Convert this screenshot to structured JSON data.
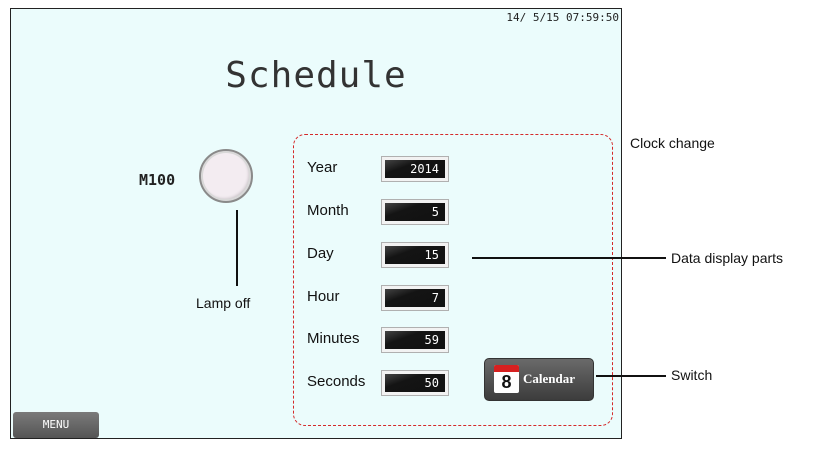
{
  "screen": {
    "clock": "14/ 5/15 07:59:50",
    "title": "Schedule",
    "lamp": {
      "label": "M100",
      "state": "off"
    },
    "fields": [
      {
        "label": "Year",
        "value": "2014"
      },
      {
        "label": "Month",
        "value": "5"
      },
      {
        "label": "Day",
        "value": "15"
      },
      {
        "label": "Hour",
        "value": "7"
      },
      {
        "label": "Minutes",
        "value": "59"
      },
      {
        "label": "Seconds",
        "value": "50"
      }
    ],
    "calendar_button": {
      "icon_number": "8",
      "label": "Calendar",
      "icon": "calendar-icon"
    },
    "menu_label": "MENU"
  },
  "annotations": {
    "lamp_off": "Lamp off",
    "clock_change": "Clock change",
    "data_display_parts": "Data display parts",
    "switch": "Switch"
  },
  "colors": {
    "screen_bg": "#ebfcfc",
    "group_border": "#d42a2a",
    "lamp_off_fill": "#f3ecf1"
  }
}
